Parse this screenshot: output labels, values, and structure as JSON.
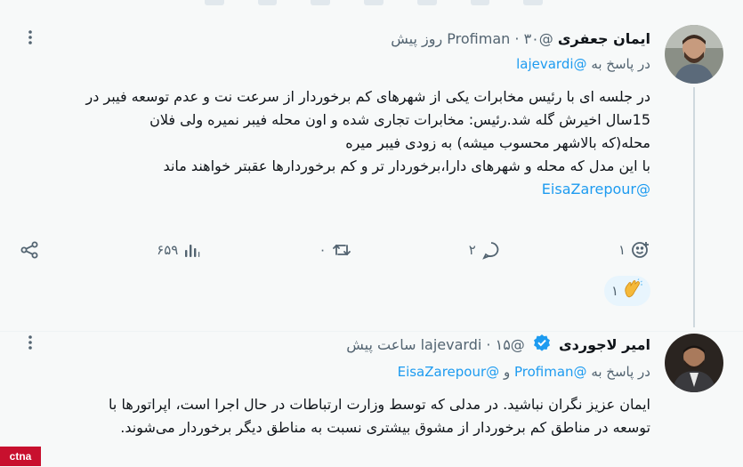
{
  "post1": {
    "name": "ایمان جعفری",
    "handle": "@Profiman",
    "dot": "·",
    "time": "۳۰ روز پیش",
    "reply_prefix": "در پاسخ به",
    "reply_handle": "@lajevardi",
    "lines": [
      "در جلسه ای با رئیس مخابرات یکی از شهرهای کم برخوردار از سرعت نت و عدم توسعه فیبر در",
      "15سال اخیرش گله شد.رئیس: مخابرات تجاری شده و اون محله فیبر نمیره ولی فلان",
      "محله(که بالاشهر محسوب میشه) به زودی فیبر میره",
      "با این مدل که محله و شهرهای دارا،برخوردار تر و کم برخوردارها عقبتر خواهند ماند"
    ],
    "mention": "@EisaZarepour",
    "actions": {
      "reactions": "۱",
      "replies": "۲",
      "reposts": "۰",
      "views": "۶۵۹"
    },
    "clap_count": "۱"
  },
  "post2": {
    "name": "امیر لاجوردی",
    "handle": "@lajevardi",
    "dot": "·",
    "time": "۱۵ ساعت پیش",
    "reply_prefix": "در پاسخ به",
    "reply_handle_1": "@Profiman",
    "reply_and": "و",
    "reply_handle_2": "@EisaZarepour",
    "lines": [
      "ایمان عزیز نگران نباشید. در مدلی که توسط وزارت ارتباطات در حال اجرا است، اپراتورها با",
      "توسعه در مناطق کم برخوردار از مشوق بیشتری نسبت به مناطق دیگر برخوردار می‌شوند."
    ]
  },
  "watermark": "ctna",
  "colors": {
    "link": "#1d9bf0",
    "muted": "#536471",
    "verified": "#1d9bf0"
  },
  "icons": [
    "more-icon",
    "reaction-icon",
    "reply-icon",
    "repost-icon",
    "views-icon",
    "share-icon",
    "clap-icon",
    "verified-icon"
  ]
}
